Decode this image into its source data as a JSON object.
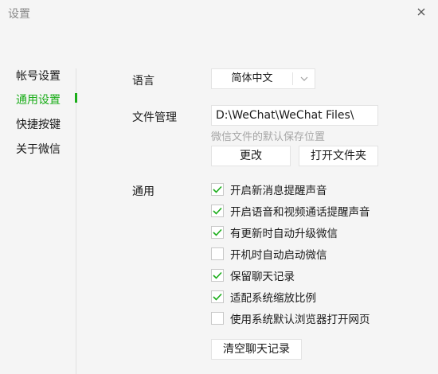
{
  "window": {
    "title": "设置",
    "close_icon": "close-icon"
  },
  "sidebar": {
    "items": [
      {
        "label": "帐号设置",
        "active": false
      },
      {
        "label": "通用设置",
        "active": true
      },
      {
        "label": "快捷按键",
        "active": false
      },
      {
        "label": "关于微信",
        "active": false
      }
    ]
  },
  "language": {
    "label": "语言",
    "selected": "简体中文",
    "arrow_icon": "chevron-down-icon"
  },
  "file_management": {
    "label": "文件管理",
    "path": "D:\\WeChat\\WeChat Files\\",
    "hint": "微信文件的默认保存位置",
    "change_button": "更改",
    "open_folder_button": "打开文件夹"
  },
  "general": {
    "label": "通用",
    "options": [
      {
        "label": "开启新消息提醒声音",
        "checked": true
      },
      {
        "label": "开启语音和视频通话提醒声音",
        "checked": true
      },
      {
        "label": "有更新时自动升级微信",
        "checked": true
      },
      {
        "label": "开机时自动启动微信",
        "checked": false
      },
      {
        "label": "保留聊天记录",
        "checked": true
      },
      {
        "label": "适配系统缩放比例",
        "checked": true
      },
      {
        "label": "使用系统默认浏览器打开网页",
        "checked": false
      }
    ],
    "clear_history_button": "清空聊天记录"
  },
  "colors": {
    "accent": "#1aad19",
    "background": "#f5f5f5",
    "border": "#e3e3e3",
    "hint": "#a6a6a6"
  }
}
